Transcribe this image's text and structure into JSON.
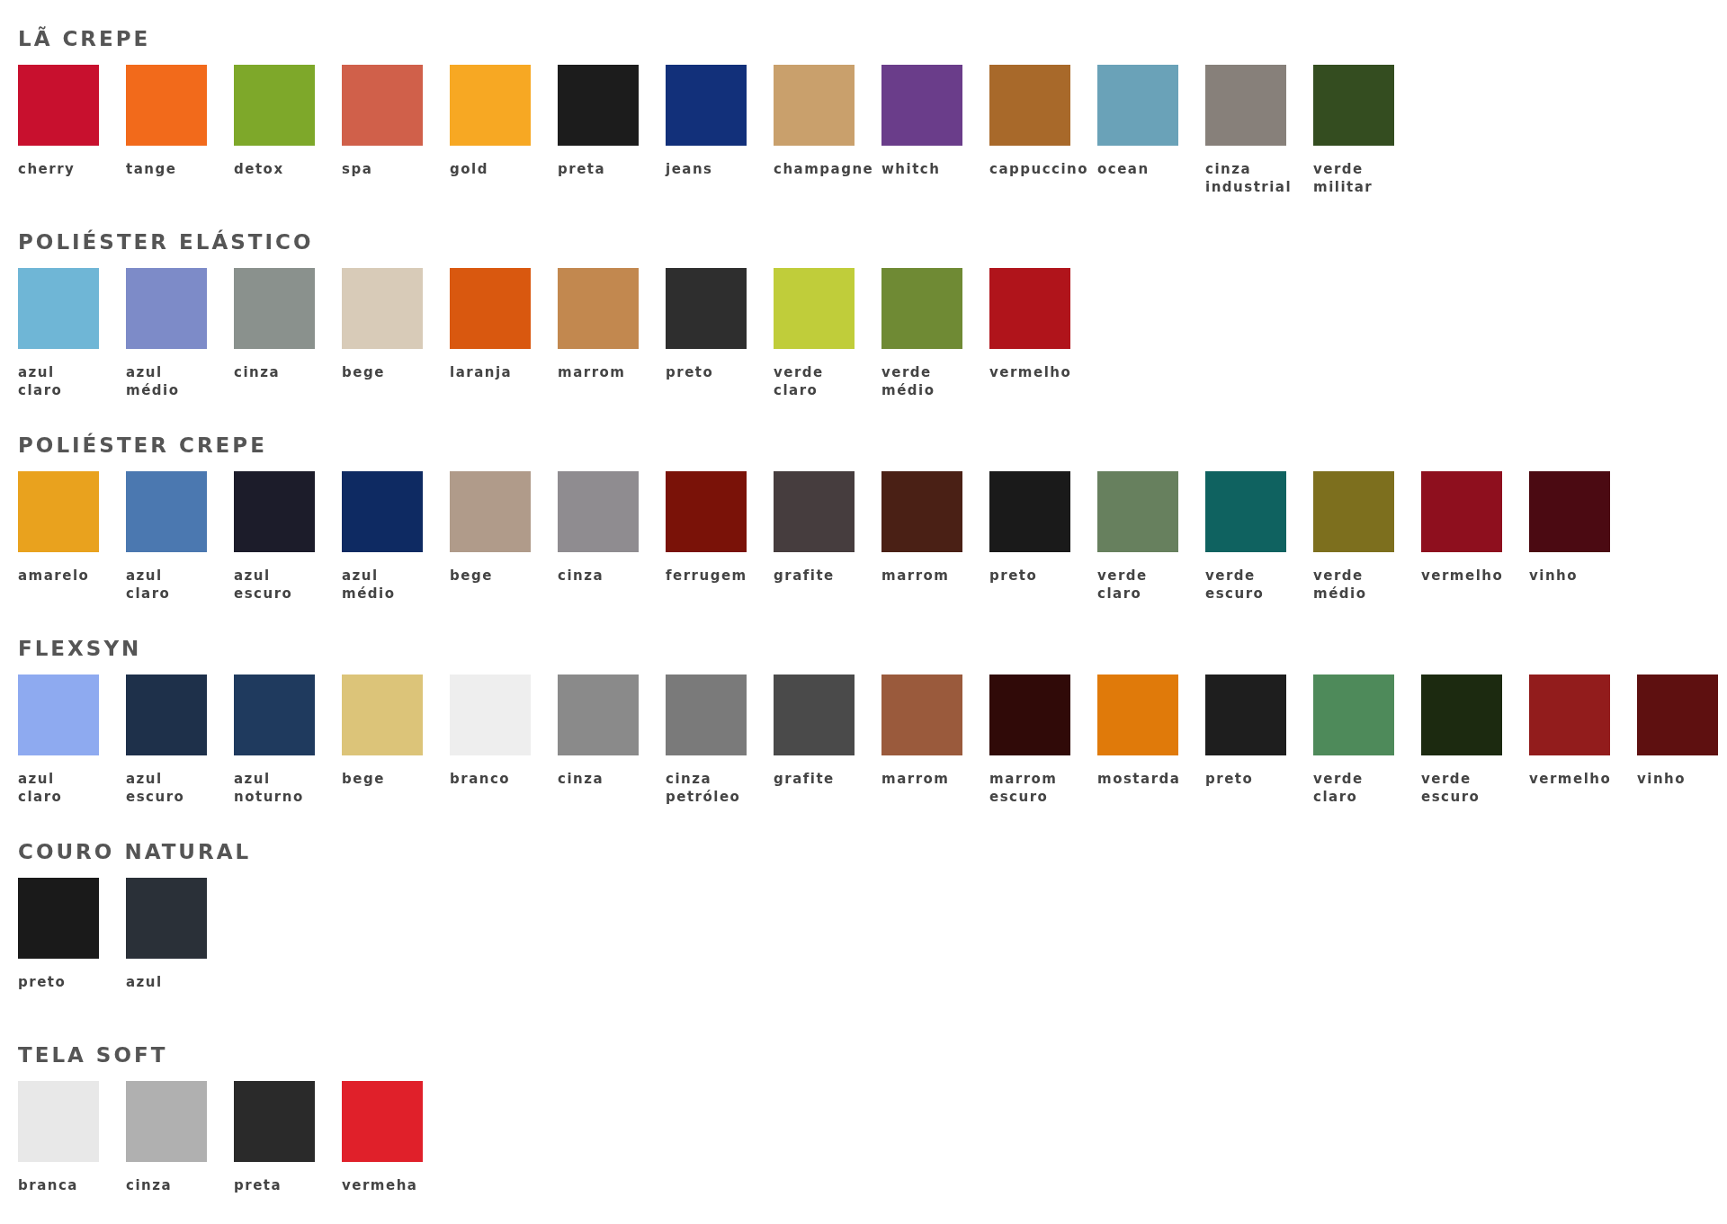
{
  "sections": [
    {
      "title": "LÃ CREPE",
      "swatches": [
        {
          "label": "cherry",
          "color": "#c8102e"
        },
        {
          "label": "tange",
          "color": "#f26a1b"
        },
        {
          "label": "detox",
          "color": "#7ea82a"
        },
        {
          "label": "spa",
          "color": "#d0604a"
        },
        {
          "label": "gold",
          "color": "#f7a823"
        },
        {
          "label": "preta",
          "color": "#1c1c1c"
        },
        {
          "label": "jeans",
          "color": "#12307a"
        },
        {
          "label": "champagne",
          "color": "#c9a06c"
        },
        {
          "label": "whitch",
          "color": "#6a3d8a"
        },
        {
          "label": "cappuccino",
          "color": "#a8692a"
        },
        {
          "label": "ocean",
          "color": "#6aa2b8"
        },
        {
          "label": "cinza industrial",
          "color": "#87807a"
        },
        {
          "label": "verde militar",
          "color": "#344d20"
        }
      ]
    },
    {
      "title": "POLIÉSTER ELÁSTICO",
      "swatches": [
        {
          "label": "azul claro",
          "color": "#6fb6d6"
        },
        {
          "label": "azul médio",
          "color": "#7d8bc8"
        },
        {
          "label": "cinza",
          "color": "#8a918d"
        },
        {
          "label": "bege",
          "color": "#d8cbb8"
        },
        {
          "label": "laranja",
          "color": "#d9580f"
        },
        {
          "label": "marrom",
          "color": "#c2884f"
        },
        {
          "label": "preto",
          "color": "#2e2e2e"
        },
        {
          "label": "verde claro",
          "color": "#c0cd3a"
        },
        {
          "label": "verde médio",
          "color": "#6f8a34"
        },
        {
          "label": "vermelho",
          "color": "#b0141b"
        }
      ]
    },
    {
      "title": "POLIÉSTER CREPE",
      "swatches": [
        {
          "label": "amarelo",
          "color": "#e9a21e"
        },
        {
          "label": "azul claro",
          "color": "#4b78b0"
        },
        {
          "label": "azul escuro",
          "color": "#1c1c2a"
        },
        {
          "label": "azul médio",
          "color": "#0e2a62"
        },
        {
          "label": "bege",
          "color": "#b09b8a"
        },
        {
          "label": "cinza",
          "color": "#8f8c90"
        },
        {
          "label": "ferrugem",
          "color": "#7a1208"
        },
        {
          "label": "grafite",
          "color": "#463d3e"
        },
        {
          "label": "marrom",
          "color": "#4a2015"
        },
        {
          "label": "preto",
          "color": "#1a1a1a"
        },
        {
          "label": "verde claro",
          "color": "#67805e"
        },
        {
          "label": "verde escuro",
          "color": "#0f6260"
        },
        {
          "label": "verde médio",
          "color": "#7d6f1e"
        },
        {
          "label": "vermelho",
          "color": "#8e0f1e"
        },
        {
          "label": "vinho",
          "color": "#4b0a12"
        }
      ]
    },
    {
      "title": "FLEXSYN",
      "swatches": [
        {
          "label": "azul claro",
          "color": "#8eaaf0"
        },
        {
          "label": "azul escuro",
          "color": "#1e304a"
        },
        {
          "label": "azul noturno",
          "color": "#1f3a5e"
        },
        {
          "label": "bege",
          "color": "#dcc479"
        },
        {
          "label": "branco",
          "color": "#eeeeee"
        },
        {
          "label": "cinza",
          "color": "#8a8a8a"
        },
        {
          "label": "cinza petróleo",
          "color": "#7a7a7a"
        },
        {
          "label": "grafite",
          "color": "#4a4a4a"
        },
        {
          "label": "marrom",
          "color": "#9a5a3c"
        },
        {
          "label": "marrom escuro",
          "color": "#300a08"
        },
        {
          "label": "mostarda",
          "color": "#e07a0a"
        },
        {
          "label": "preto",
          "color": "#1e1e1e"
        },
        {
          "label": "verde claro",
          "color": "#4e8a5a"
        },
        {
          "label": "verde escuro",
          "color": "#1c2a10"
        },
        {
          "label": "vermelho",
          "color": "#921c1c"
        },
        {
          "label": "vinho",
          "color": "#5e1010"
        }
      ]
    },
    {
      "title": "COURO NATURAL",
      "swatches": [
        {
          "label": "preto",
          "color": "#1a1a1a"
        },
        {
          "label": "azul",
          "color": "#2a3038"
        }
      ]
    },
    {
      "title": "TELA SOFT",
      "swatches": [
        {
          "label": "branca",
          "color": "#e8e8e8"
        },
        {
          "label": "cinza",
          "color": "#b0b0b0"
        },
        {
          "label": "preta",
          "color": "#2a2a2a"
        },
        {
          "label": "vermeha",
          "color": "#e0202a"
        }
      ]
    }
  ]
}
